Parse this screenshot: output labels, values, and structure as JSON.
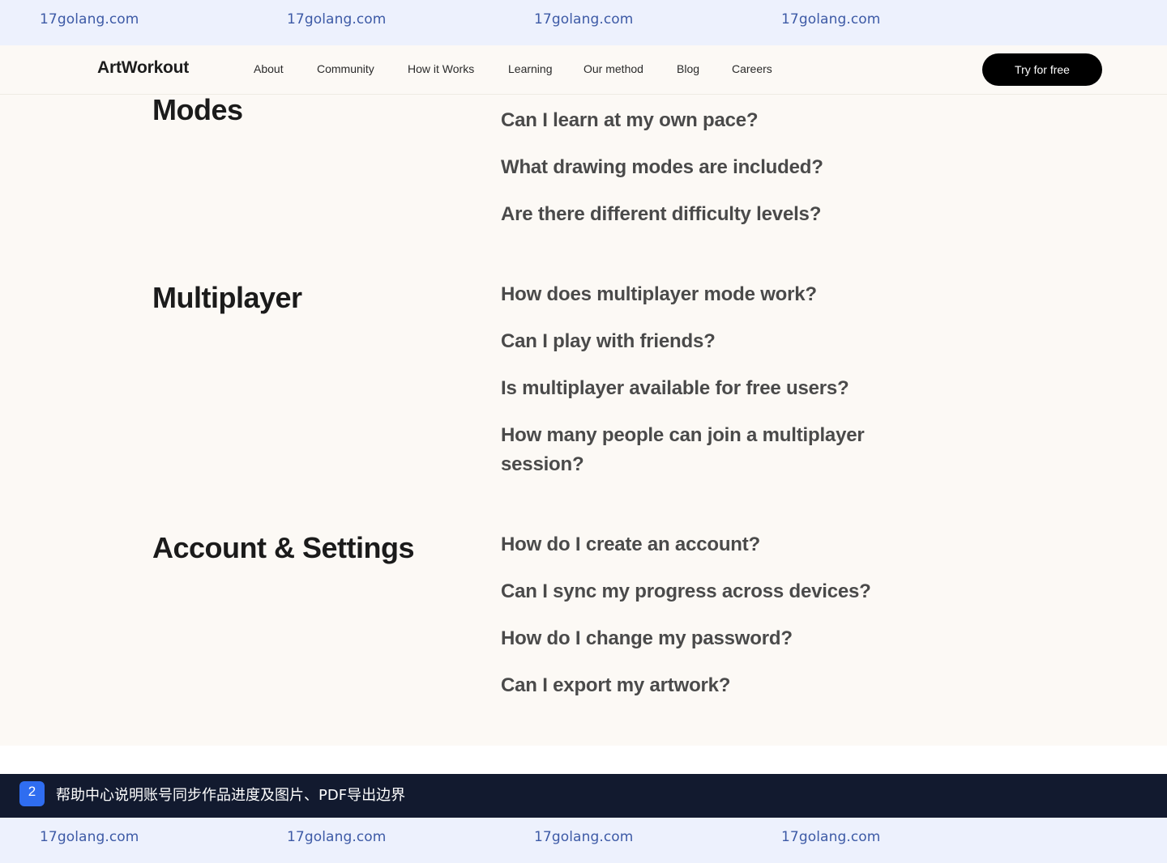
{
  "watermark": {
    "text": "17golang.com"
  },
  "nav": {
    "brand": "ArtWorkout",
    "links": [
      "About",
      "Community",
      "How it Works",
      "Learning",
      "Our method",
      "Blog",
      "Careers"
    ],
    "cta": "Try for free"
  },
  "faq": {
    "sections": [
      {
        "title": "Modes",
        "questions": [
          "Can I learn at my own pace?",
          "What drawing modes are included?",
          "Are there different difficulty levels?"
        ]
      },
      {
        "title": "Multiplayer",
        "questions": [
          "How does multiplayer mode work?",
          "Can I play with friends?",
          "Is multiplayer available for free users?",
          "How many people can join a multiplayer session?"
        ]
      },
      {
        "title": "Account & Settings",
        "questions": [
          "How do I create an account?",
          "Can I sync my progress across devices?",
          "How do I change my password?",
          "Can I export my artwork?"
        ]
      }
    ]
  },
  "banner": {
    "badge": "2",
    "text": "帮助中心说明账号同步作品进度及图片、PDF导出边界"
  },
  "colors": {
    "watermark_bg": "#edf1fd",
    "watermark_text": "#3d5aa6",
    "page_bg": "#fcf9f5",
    "cta_bg": "#000000",
    "banner_bg": "#121a2f",
    "badge_bg": "#2f6df0"
  }
}
